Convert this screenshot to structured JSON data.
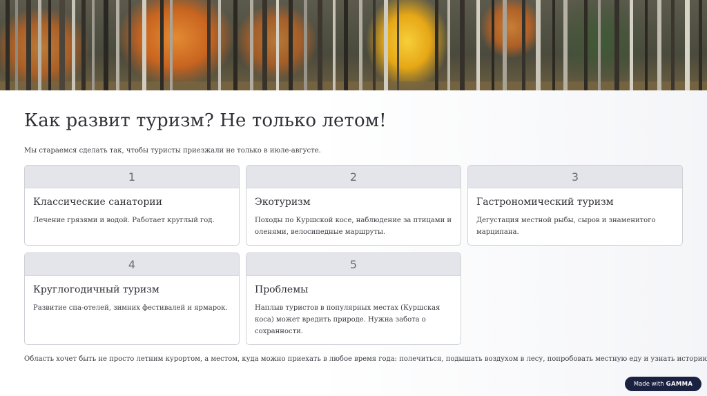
{
  "page": {
    "title": "Как развит туризм? Не только летом!",
    "intro": "Мы стараемся сделать так, чтобы туристы приезжали не только в июле-августе.",
    "footer": "Область хочет быть не просто летним курортом, а местом, куда можно приехать в любое время года: полечиться, подышать воздухом в лесу, попробовать местную еду и узнать историю."
  },
  "cards": [
    {
      "number": "1",
      "title": "Классические санатории",
      "text": "Лечение грязями и водой. Работает круглый год."
    },
    {
      "number": "2",
      "title": "Экотуризм",
      "text": "Походы по Куршской косе, наблюдение за птицами и оленями, велосипедные маршруты."
    },
    {
      "number": "3",
      "title": "Гастрономический туризм",
      "text": "Дегустация местной рыбы, сыров и знаменитого марципана."
    },
    {
      "number": "4",
      "title": "Круглогодичный туризм",
      "text": "Развитие спа-отелей, зимних фестивалей и ярмарок."
    },
    {
      "number": "5",
      "title": "Проблемы",
      "text": "Наплыв туристов в популярных местах (Куршская коса) может вредить природе. Нужна забота о сохранности."
    }
  ],
  "badge": {
    "prefix": "Made with",
    "brand": "GAMMA"
  },
  "colors": {
    "card_header": "#e4e5ea",
    "card_border": "#cfd0d6",
    "badge_bg": "#1b2140",
    "forest_orange": "#d9772a",
    "forest_yellow": "#e9b21c"
  }
}
